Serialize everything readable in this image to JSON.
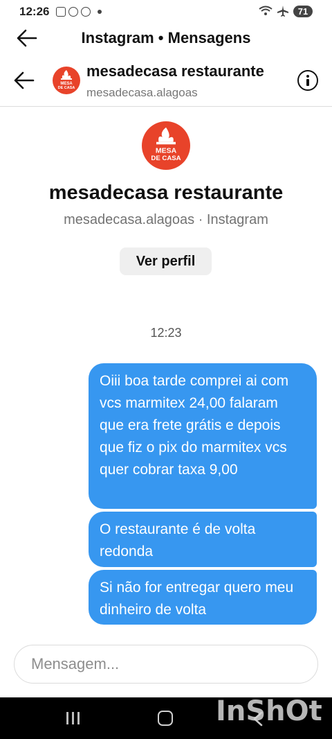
{
  "status_bar": {
    "time": "12:26",
    "battery": "71"
  },
  "top_bar": {
    "title": "Instagram • Mensagens"
  },
  "conversation_header": {
    "name": "mesadecasa restaurante",
    "handle": "mesadecasa.alagoas"
  },
  "logo": {
    "line1": "MESA",
    "line2": "DE CASA",
    "brand_color": "#e8432a"
  },
  "profile": {
    "name": "mesadecasa restaurante",
    "subtitle": "mesadecasa.alagoas · Instagram",
    "view_profile_label": "Ver perfil"
  },
  "thread": {
    "timestamp": "12:23",
    "messages": [
      "Oiii boa tarde comprei ai com vcs marmitex 24,00 falaram que era frete grátis e depois que fiz o pix do marmitex vcs quer cobrar taxa 9,00",
      "O restaurante é de volta redonda",
      "Si não for entregar quero meu dinheiro de volta"
    ],
    "bubble_color": "#3797f0"
  },
  "composer": {
    "placeholder": "Mensagem...",
    "value": ""
  },
  "watermark": "InShOt"
}
